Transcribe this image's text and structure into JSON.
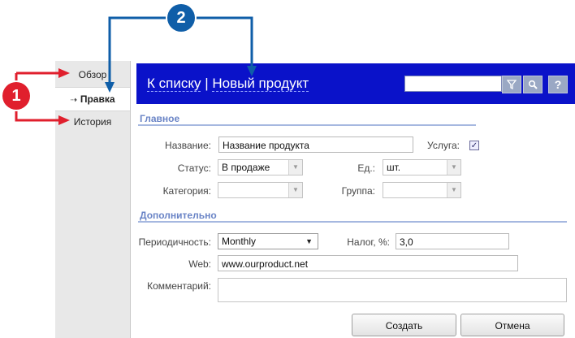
{
  "callouts": {
    "badge_1": "1",
    "badge_2": "2"
  },
  "nav": {
    "items": [
      {
        "label": "Обзор"
      },
      {
        "label": "Правка",
        "arrow": "⇢"
      },
      {
        "label": "История"
      }
    ]
  },
  "header": {
    "link_text": "К списку",
    "separator": " | ",
    "title": "Новый продукт",
    "search_value": "",
    "help_label": "?"
  },
  "sections": {
    "main_title": "Главное",
    "extra_title": "Дополнительно"
  },
  "form": {
    "name_label": "Название:",
    "name_value": "Название продукта",
    "service_label": "Услуга:",
    "service_checked": "✓",
    "status_label": "Статус:",
    "status_value": "В продаже",
    "unit_label": "Ед.:",
    "unit_value": "шт.",
    "category_label": "Категория:",
    "category_value": "",
    "group_label": "Группа:",
    "group_value": "",
    "period_label": "Периодичность:",
    "period_value": "Monthly",
    "tax_label": "Налог, %:",
    "tax_value": "3,0",
    "web_label": "Web:",
    "web_value": "www.ourproduct.net",
    "comment_label": "Комментарий:",
    "comment_value": ""
  },
  "buttons": {
    "create": "Создать",
    "cancel": "Отмена"
  },
  "colors": {
    "header_bg": "#0a12c9",
    "callout_red": "#e01f2d",
    "callout_blue": "#0f5ea8",
    "section_title": "#6a84c6"
  }
}
